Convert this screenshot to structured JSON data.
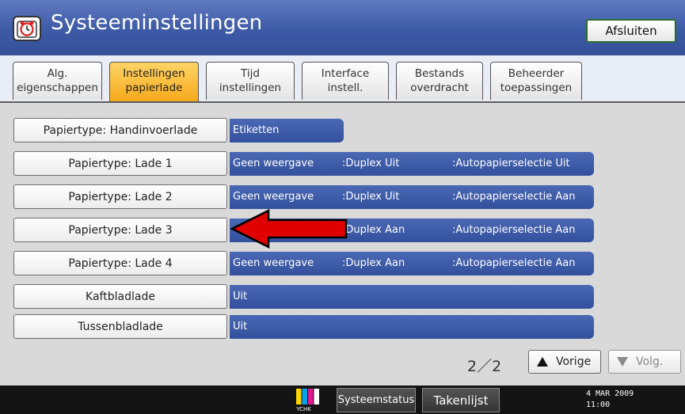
{
  "header": {
    "icon": "settings-alarm-clock-icon",
    "title": "Systeeminstellingen",
    "exit_label": "Afsluiten"
  },
  "tabs": [
    {
      "line1": "Alg.",
      "line2": "eigenschappen",
      "active": false
    },
    {
      "line1": "Instellingen",
      "line2": "papierlade",
      "active": true
    },
    {
      "line1": "Tijd",
      "line2": "instellingen",
      "active": false
    },
    {
      "line1": "Interface",
      "line2": "instell.",
      "active": false
    },
    {
      "line1": "Bestands",
      "line2": "overdracht",
      "active": false
    },
    {
      "line1": "Beheerder",
      "line2": "toepassingen",
      "active": false
    }
  ],
  "rows": [
    {
      "label": "Papiertype: Handinvoerlade",
      "values": [
        "Etiketten"
      ]
    },
    {
      "label": "Papiertype: Lade 1",
      "values": [
        "Geen weergave",
        ":Duplex Uit",
        ":Autopapierselectie Uit"
      ]
    },
    {
      "label": "Papiertype: Lade 2",
      "values": [
        "Geen weergave",
        ":Duplex Uit",
        ":Autopapierselectie Aan"
      ]
    },
    {
      "label": "Papiertype: Lade 3",
      "values": [
        "",
        ":Duplex Aan",
        ":Autopapierselectie Aan"
      ]
    },
    {
      "label": "Papiertype: Lade 4",
      "values": [
        "Geen weergave",
        ":Duplex Aan",
        ":Autopapierselectie Aan"
      ]
    },
    {
      "label": "Kaftbladlade",
      "values": [
        "Uit"
      ]
    },
    {
      "label": "Tussenbladlade",
      "values": [
        "Uit"
      ]
    }
  ],
  "pager": {
    "indicator": "2／2",
    "prev_label": "Vorige",
    "next_label": "Volg."
  },
  "statusbar": {
    "logo_text": "YCHK",
    "status_label": "Systeemstatus",
    "jobs_label": "Takenlijst",
    "date": "4 MAR  2009",
    "time": "11:00"
  },
  "colors": {
    "titlebar": "#3d5aa6",
    "active_tab": "#f5a91b",
    "value_bar": "#3a55a0",
    "annotation_arrow": "#e00000",
    "exit_border": "#2a6b2a"
  }
}
